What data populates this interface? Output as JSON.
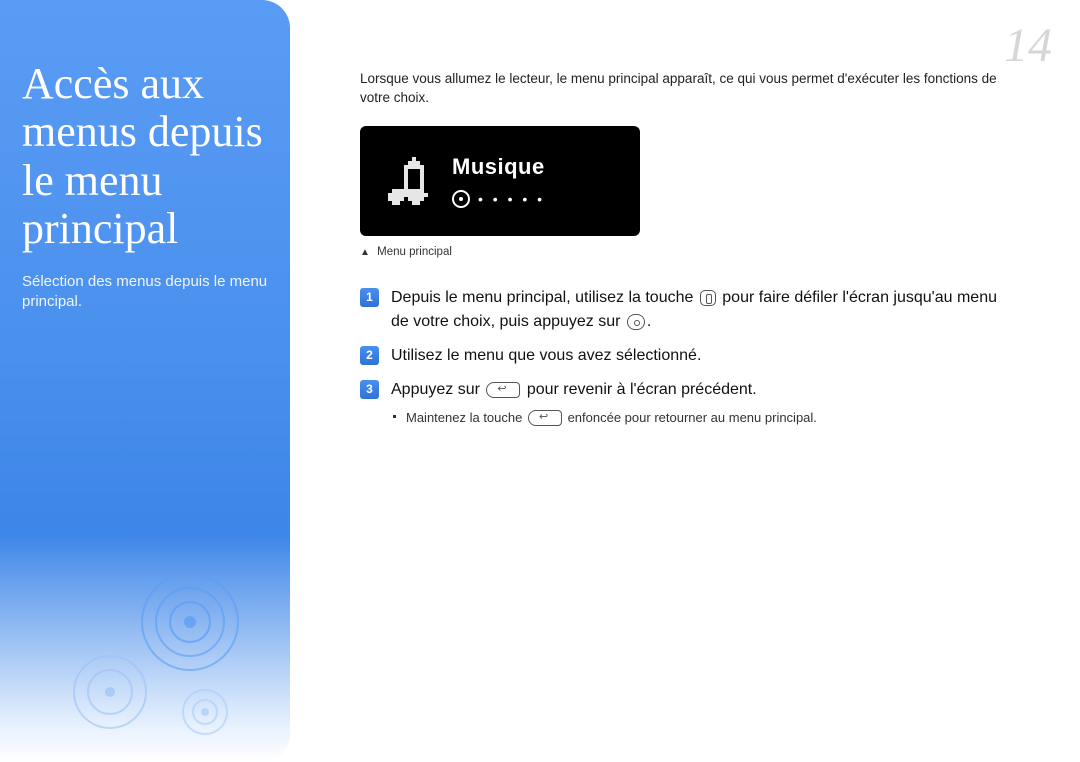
{
  "page_number": "14",
  "sidebar": {
    "title": "Accès aux menus depuis le menu principal",
    "subtitle": "Sélection des menus depuis le menu principal."
  },
  "intro": "Lorsque vous allumez le lecteur, le menu principal apparaît, ce qui vous permet d'exécuter les fonctions de votre choix.",
  "screen": {
    "title": "Musique",
    "dots": "• • • • •"
  },
  "caption": {
    "marker": "▲",
    "text": "Menu principal"
  },
  "steps": [
    {
      "num": "1",
      "pre": "Depuis le menu principal, utilisez la touche ",
      "mid": " pour faire défiler l'écran jusqu'au menu de votre choix, puis appuyez sur ",
      "post": "."
    },
    {
      "num": "2",
      "text": "Utilisez le menu que vous avez sélectionné."
    },
    {
      "num": "3",
      "pre": "Appuyez sur ",
      "post": " pour revenir à l'écran précédent.",
      "sub_pre": "Maintenez la touche ",
      "sub_post": " enfoncée pour retourner au menu principal."
    }
  ]
}
